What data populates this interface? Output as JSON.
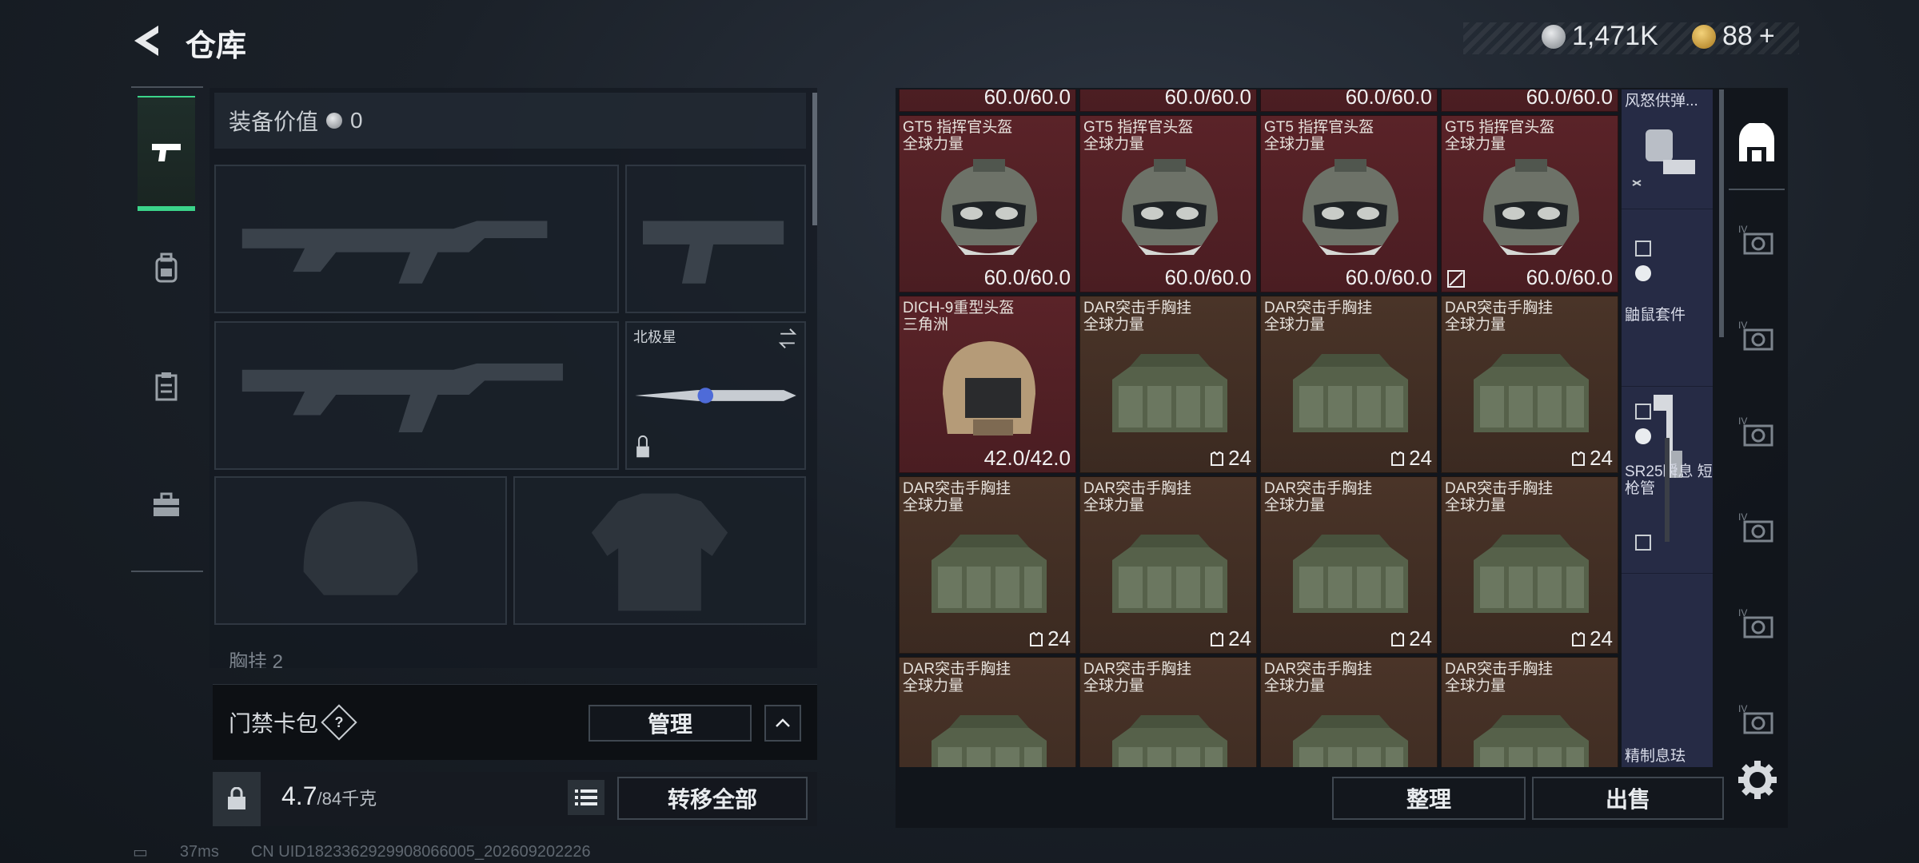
{
  "header": {
    "title": "仓库",
    "silver_amount": "1,471K",
    "gold_amount": "88",
    "gold_plus": "+"
  },
  "sidebar": {
    "tabs": [
      {
        "icon": "pistol-icon",
        "active": true
      },
      {
        "icon": "backpack-icon",
        "active": false
      },
      {
        "icon": "clipboard-icon",
        "active": false
      },
      {
        "icon": "toolbox-icon",
        "active": false
      }
    ]
  },
  "loadout": {
    "equip_value_label": "装备价值",
    "equip_value": "0",
    "melee_slot_label": "北极星",
    "chest_label": "胸挂 2"
  },
  "keycard": {
    "label": "门禁卡包",
    "help": "?",
    "manage_label": "管理"
  },
  "weight": {
    "current": "4.7",
    "max": "/84千克",
    "transfer_all_label": "转移全部"
  },
  "stash": {
    "top_row_durability": [
      "60.0/60.0",
      "60.0/60.0",
      "60.0/60.0",
      "60.0/60.0"
    ],
    "rows": [
      [
        {
          "name": "GT5 指挥官头盔",
          "sub": "全球力量",
          "value": "60.0/60.0",
          "kind": "helmet",
          "color": "red"
        },
        {
          "name": "GT5 指挥官头盔",
          "sub": "全球力量",
          "value": "60.0/60.0",
          "kind": "helmet",
          "color": "red"
        },
        {
          "name": "GT5 指挥官头盔",
          "sub": "全球力量",
          "value": "60.0/60.0",
          "kind": "helmet",
          "color": "red"
        },
        {
          "name": "GT5 指挥官头盔",
          "sub": "全球力量",
          "value": "60.0/60.0",
          "kind": "helmet",
          "color": "red"
        }
      ],
      [
        {
          "name": "DICH-9重型头盔",
          "sub": "三角洲",
          "value": "42.0/42.0",
          "kind": "heavy-helmet",
          "color": "red"
        },
        {
          "name": "DAR突击手胸挂",
          "sub": "全球力量",
          "value": "24",
          "kind": "rig",
          "color": "brown"
        },
        {
          "name": "DAR突击手胸挂",
          "sub": "全球力量",
          "value": "24",
          "kind": "rig",
          "color": "brown"
        },
        {
          "name": "DAR突击手胸挂",
          "sub": "全球力量",
          "value": "24",
          "kind": "rig",
          "color": "brown"
        }
      ],
      [
        {
          "name": "DAR突击手胸挂",
          "sub": "全球力量",
          "value": "24",
          "kind": "rig",
          "color": "brown"
        },
        {
          "name": "DAR突击手胸挂",
          "sub": "全球力量",
          "value": "24",
          "kind": "rig",
          "color": "brown"
        },
        {
          "name": "DAR突击手胸挂",
          "sub": "全球力量",
          "value": "24",
          "kind": "rig",
          "color": "brown"
        },
        {
          "name": "DAR突击手胸挂",
          "sub": "全球力量",
          "value": "24",
          "kind": "rig",
          "color": "brown"
        }
      ],
      [
        {
          "name": "DAR突击手胸挂",
          "sub": "全球力量",
          "value": "",
          "kind": "rig",
          "color": "brown"
        },
        {
          "name": "DAR突击手胸挂",
          "sub": "全球力量",
          "value": "",
          "kind": "rig",
          "color": "brown"
        },
        {
          "name": "DAR突击手胸挂",
          "sub": "全球力量",
          "value": "",
          "kind": "rig",
          "color": "brown"
        },
        {
          "name": "DAR突击手胸挂",
          "sub": "全球力量",
          "value": "",
          "kind": "rig",
          "color": "brown"
        }
      ]
    ],
    "side_items": [
      {
        "name": "风怒供弹..."
      },
      {
        "name": "鼬鼠套件"
      },
      {
        "name": "SR25瞬息\n短枪管"
      },
      {
        "name": "精制息珐"
      }
    ],
    "organize_label": "整理",
    "sell_label": "出售"
  },
  "status": {
    "ping": "37ms",
    "uid": "CN UID1823362929908066005_202609202226"
  },
  "colors": {
    "accent_green": "#3bd48a",
    "cell_red": "#5a2328",
    "cell_brown": "#4a3428",
    "side_column": "#262b45"
  }
}
